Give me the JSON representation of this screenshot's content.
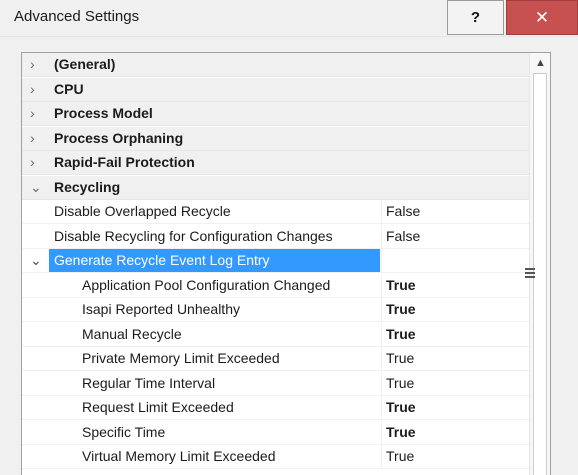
{
  "window": {
    "title": "Advanced Settings",
    "help_label": "?",
    "close_label": "✕"
  },
  "grid": {
    "categories_top": [
      {
        "label": "(General)"
      },
      {
        "label": "CPU"
      },
      {
        "label": "Process Model"
      },
      {
        "label": "Process Orphaning"
      },
      {
        "label": "Rapid-Fail Protection"
      }
    ],
    "recycling": {
      "label": "Recycling",
      "properties": [
        {
          "name": "Disable Overlapped Recycle",
          "value": "False"
        },
        {
          "name": "Disable Recycling for Configuration Changes",
          "value": "False"
        }
      ],
      "log_entry": {
        "label": "Generate Recycle Event Log Entry",
        "items": [
          {
            "name": "Application Pool Configuration Changed",
            "value": "True",
            "bold": true
          },
          {
            "name": "Isapi Reported Unhealthy",
            "value": "True",
            "bold": true
          },
          {
            "name": "Manual Recycle",
            "value": "True",
            "bold": true
          },
          {
            "name": "Private Memory Limit Exceeded",
            "value": "True",
            "bold": false
          },
          {
            "name": "Regular Time Interval",
            "value": "True",
            "bold": false
          },
          {
            "name": "Request Limit Exceeded",
            "value": "True",
            "bold": true
          },
          {
            "name": "Specific Time",
            "value": "True",
            "bold": true
          },
          {
            "name": "Virtual Memory Limit Exceeded",
            "value": "True",
            "bold": false
          }
        ]
      }
    }
  },
  "colors": {
    "selection": "#3399ff",
    "close_button": "#c75050"
  },
  "icons": {
    "collapsed": "chevron-right-icon",
    "expanded": "chevron-down-icon",
    "scroll_up": "scroll-up-arrow-icon",
    "thumb_grip": "grip-icon"
  }
}
